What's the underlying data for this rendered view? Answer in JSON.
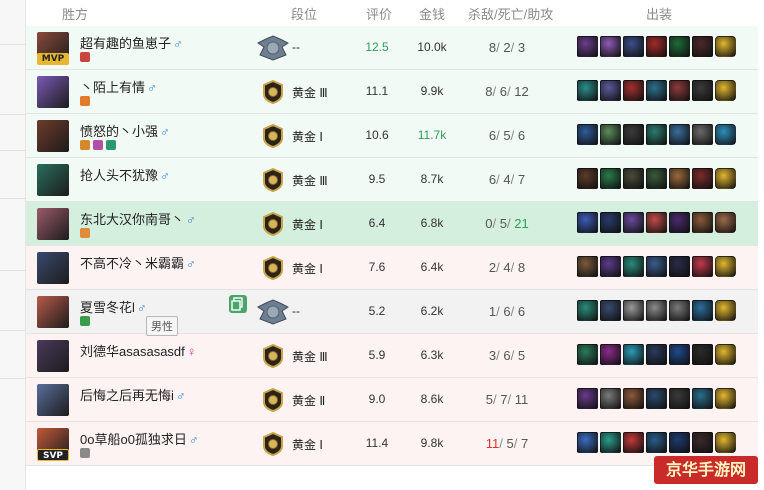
{
  "columns": {
    "winner": "胜方",
    "rank": "段位",
    "score": "评价",
    "gold": "金钱",
    "kda": "杀敌/死亡/助攻",
    "items": "出装"
  },
  "tooltip": "男性",
  "watermark": "京华手游网",
  "players": [
    {
      "name": "超有趣的鱼崽子",
      "gender": "♂",
      "badge": "MVP",
      "rank": "--",
      "score": "12.5",
      "gold": "10.0k",
      "kills": "8",
      "deaths": "2",
      "assists": "3",
      "result": "win",
      "avatar_color": "#8a4a3a",
      "sub_colors": [
        "#c9473f"
      ],
      "items": [
        "#6b3c8c",
        "#8c5ab5",
        "#3b4f8a",
        "#a32a2a",
        "#1d6b3a",
        "#4c2a2a",
        "#e2b62e"
      ]
    },
    {
      "name": "丶陌上有情",
      "gender": "♂",
      "badge": "",
      "rank": "黄金 Ⅲ",
      "score": "11.1",
      "gold": "9.9k",
      "kills": "8",
      "deaths": "6",
      "assists": "12",
      "result": "win",
      "avatar_color": "#7b5ab8",
      "sub_colors": [
        "#e37b2a"
      ],
      "items": [
        "#2c8c8c",
        "#5a5a9c",
        "#a22f2f",
        "#2d6e8e",
        "#8c3a3a",
        "#3a3a3a",
        "#e2b62e"
      ]
    },
    {
      "name": "愤怒的丶小强",
      "gender": "♂",
      "badge": "",
      "rank": "黄金 Ⅰ",
      "score": "10.6",
      "gold": "11.7k",
      "kills": "6",
      "deaths": "5",
      "assists": "6",
      "result": "win",
      "avatar_color": "#6e3b2a",
      "sub_colors": [
        "#d4892a",
        "#b24fa8",
        "#2a9a6e"
      ],
      "items": [
        "#2f5c9c",
        "#5c8c5c",
        "#3b3b3b",
        "#2a7c6c",
        "#3a6e9c",
        "#6a6a6a",
        "#2f8ec0"
      ]
    },
    {
      "name": "抢人头不犹豫",
      "gender": "♂",
      "badge": "",
      "rank": "黄金 Ⅲ",
      "score": "9.5",
      "gold": "8.7k",
      "kills": "6",
      "deaths": "4",
      "assists": "7",
      "result": "win",
      "avatar_color": "#2a6e5c",
      "sub_colors": [],
      "items": [
        "#5c3b2a",
        "#2a7c4a",
        "#4a4a3a",
        "#3a5a3a",
        "#9c6a3a",
        "#7c2a2a",
        "#e2b62e"
      ]
    },
    {
      "name": "东北大汉你南哥丶",
      "gender": "♂",
      "badge": "",
      "rank": "黄金 Ⅰ",
      "score": "6.4",
      "gold": "6.8k",
      "kills": "0",
      "deaths": "5",
      "assists": "21",
      "result": "win-hl",
      "avatar_color": "#9c5a6a",
      "sub_colors": [
        "#e08a3a"
      ],
      "items": [
        "#3b5cb8",
        "#2a3a6e",
        "#6a4a9c",
        "#c24a4a",
        "#4a2a6e",
        "#8a5a3a",
        "#9c6a4a"
      ]
    },
    {
      "name": "不高不冷丶米霸霸",
      "gender": "♂",
      "badge": "",
      "rank": "黄金 Ⅰ",
      "score": "7.6",
      "gold": "6.4k",
      "kills": "2",
      "deaths": "4",
      "assists": "8",
      "result": "lose",
      "avatar_color": "#3a4a6e",
      "sub_colors": [],
      "items": [
        "#7c5a3a",
        "#5c3a8c",
        "#2a8c7c",
        "#3a5c8c",
        "#2a2a4a",
        "#c23a4a",
        "#e2b62e"
      ]
    },
    {
      "name": "夏雪冬花l",
      "gender": "♂",
      "badge": "",
      "rank": "--",
      "score": "5.2",
      "gold": "6.2k",
      "kills": "1",
      "deaths": "6",
      "assists": "6",
      "result": "lose-hl",
      "avatar_color": "#b85a4a",
      "sub_colors": [
        "#3a9c4a"
      ],
      "items": [
        "#2a8c7c",
        "#3a4a6e",
        "#9a9a9a",
        "#8a8a8a",
        "#7a7a7a",
        "#2a6e9c",
        "#e2b62e"
      ]
    },
    {
      "name": "刘德华asasasasdf",
      "gender": "♀",
      "badge": "",
      "rank": "黄金 Ⅲ",
      "score": "5.9",
      "gold": "6.3k",
      "kills": "3",
      "deaths": "6",
      "assists": "5",
      "result": "lose",
      "avatar_color": "#4a3a5c",
      "sub_colors": [],
      "items": [
        "#2a7c5c",
        "#8c2a8c",
        "#2a9cb8",
        "#2a3a5c",
        "#1e4a8c",
        "#2a2a2a",
        "#e2b62e"
      ]
    },
    {
      "name": "后悔之后再无悔i",
      "gender": "♂",
      "badge": "",
      "rank": "黄金 Ⅱ",
      "score": "9.0",
      "gold": "8.6k",
      "kills": "5",
      "deaths": "7",
      "assists": "11",
      "result": "lose",
      "avatar_color": "#5a6e9c",
      "sub_colors": [],
      "items": [
        "#6a3a8c",
        "#7a7a7a",
        "#8c5a3a",
        "#2a4a6e",
        "#3a3a3a",
        "#2a6e8c",
        "#e2b62e"
      ]
    },
    {
      "name": "0o草船o0孤独求日",
      "gender": "♂",
      "badge": "SVP",
      "rank": "黄金 Ⅰ",
      "score": "11.4",
      "gold": "9.8k",
      "kills": "11",
      "deaths": "5",
      "assists": "7",
      "result": "lose",
      "avatar_color": "#c25a3a",
      "sub_colors": [
        "#8a8a8a"
      ],
      "items": [
        "#3a6ec2",
        "#2a9c8c",
        "#c23a3a",
        "#2a5c8c",
        "#1e3a6e",
        "#3a2a2a",
        "#e2b62e"
      ]
    }
  ]
}
